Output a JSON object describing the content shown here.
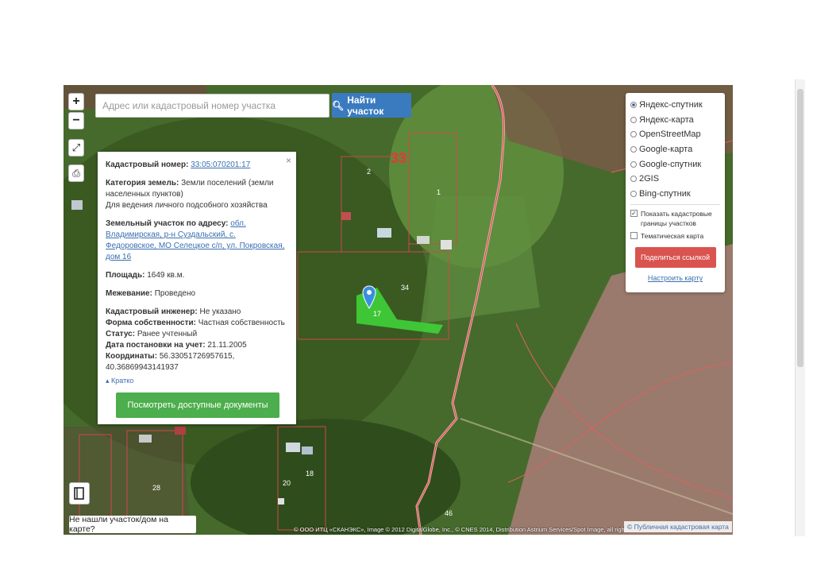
{
  "search": {
    "placeholder": "Адрес или кадастровый номер участка",
    "button_label": "Найти участок"
  },
  "controls": {
    "zoom_in": "+",
    "zoom_out": "−"
  },
  "popup": {
    "cadastral_label": "Кадастровый номер:",
    "cadastral_value": "33:05:070201:17",
    "category_label": "Категория земель:",
    "category_value": "Земли поселений (земли населенных пунктов)",
    "usage_value": "Для ведения личного подсобного хозяйства",
    "address_label": "Земельный участок по адресу:",
    "address_value": "обл. Владимирская, р-н Суздальский, с. Федоровское, МО Селецкое с/п, ул. Покровская, дом 16",
    "area_label": "Площадь:",
    "area_value": "1649 кв.м.",
    "survey_label": "Межевание:",
    "survey_value": "Проведено",
    "engineer_label": "Кадастровый инженер:",
    "engineer_value": "Не указано",
    "ownership_label": "Форма собственности:",
    "ownership_value": "Частная собственность",
    "status_label": "Статус:",
    "status_value": "Ранее учтенный",
    "date_label": "Дата постановки на учет:",
    "date_value": "21.11.2005",
    "coords_label": "Координаты:",
    "coords_value": "56.33051726957615, 40.36869943141937",
    "brief_link": "Кратко",
    "docs_button": "Посмотреть доступные документы",
    "close": "×"
  },
  "layers": {
    "options": [
      "Яндекс-спутник",
      "Яндекс-карта",
      "OpenStreetMap",
      "Google-карта",
      "Google-спутник",
      "2GIS",
      "Bing-спутник"
    ],
    "selected_index": 0,
    "show_borders_label": "Показать кадастровые границы участков",
    "show_borders_checked": true,
    "thematic_label": "Тематическая карта",
    "thematic_checked": false,
    "share_button": "Поделиться ссылкой",
    "setup_link": "Настроить карту"
  },
  "map_labels": {
    "quarter": "33",
    "plot_highlight": "17",
    "plot_numbers": [
      "2",
      "1",
      "34",
      "28",
      "20",
      "18",
      "46"
    ]
  },
  "not_found_button": "Не нашли участок/дом на карте?",
  "copyright": "© ООО ИТЦ «СКАНЭКС», Image © 2012 DigitalGlobe, Inc., © CNES 2014, Distribution Astrium Services/Spot Image, all rights",
  "pkk_link": "© Публичная кадастровая карта",
  "colors": {
    "search_button": "#3a7bc0",
    "docs_button": "#4cae4c",
    "share_button": "#d9534f",
    "plot_fill": "#3fd93a",
    "boundary": "#e04040"
  }
}
